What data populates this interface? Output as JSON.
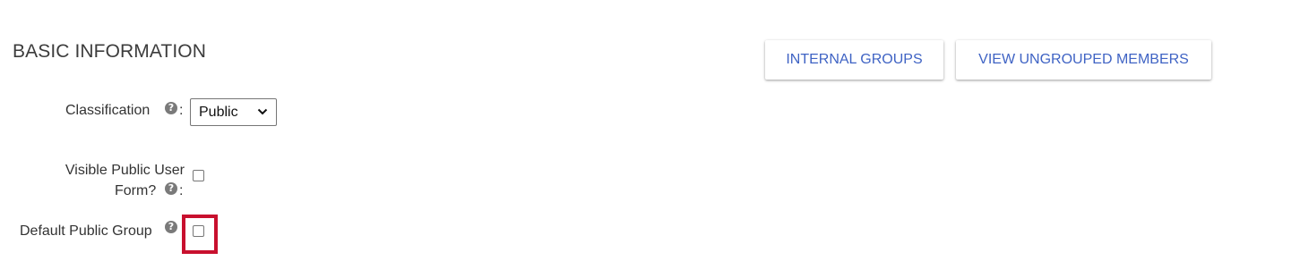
{
  "section": {
    "title": "BASIC INFORMATION"
  },
  "actions": {
    "internal_groups_label": "INTERNAL GROUPS",
    "view_ungrouped_members_label": "VIEW UNGROUPED MEMBERS"
  },
  "form": {
    "classification": {
      "label": "Classification",
      "help_icon": "?",
      "colon": ":",
      "selected": "Public"
    },
    "visible_public_user_form": {
      "label_line1": "Visible Public User",
      "label_line2": "Form?",
      "help_icon": "?",
      "colon": ":",
      "checked": false
    },
    "default_public_group": {
      "label": "Default Public Group",
      "help_icon": "?",
      "checked": false
    }
  },
  "colors": {
    "accent": "#3f63c4",
    "highlight": "#c8102e",
    "help_icon": "#7a7a7a"
  }
}
